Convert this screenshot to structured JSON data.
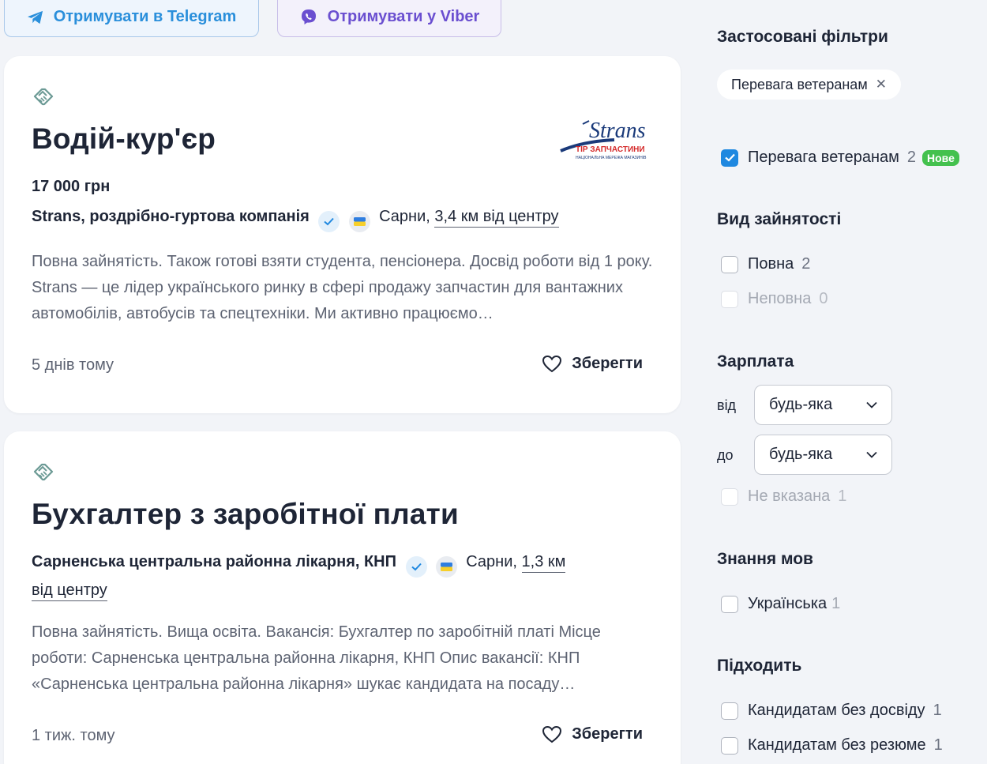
{
  "subscribe": {
    "telegram_label": "Отримувати в Telegram",
    "viber_label": "Отримувати у Viber"
  },
  "jobs": [
    {
      "title": "Водій-кур'єр",
      "salary": "17 000 грн",
      "company": "Strans, роздрібно-гуртова компанія",
      "city": "Сарни,",
      "distance": "3,4 км від центру",
      "description": "Повна зайнятість. Також готові взяти студента, пенсіонера. Досвід роботи від 1 року. Strans — це лідер українського ринку в сфері продажу запчастин для вантажних автомобілів, автобусів та спецтехніки. Ми активно працюємо…",
      "posted": "5 днів тому",
      "save_label": "Зберегти",
      "logo": {
        "text": "Strans",
        "subtext": "ТІР ЗАПЧАСТИНИ",
        "tagline": "НАЦІОНАЛЬНА МЕРЕЖА МАГАЗИНІВ"
      }
    },
    {
      "title": "Бухгалтер з заробітної плати",
      "company": "Сарненська центральна районна лікарня, КНП",
      "city": "Сарни,",
      "distance": "1,3 км від центру",
      "description": "Повна зайнятість. Вища освіта. Вакансія: Бухгалтер по заробітній платі Місце роботи: Сарненська центральна районна лікарня, КНП Опис вакансії: КНП «Сарненська центральна районна лікарня» шукає кандидата на посаду…",
      "posted": "1 тиж. тому",
      "save_label": "Зберегти"
    }
  ],
  "filters": {
    "applied_title": "Застосовані фільтри",
    "applied_chip": "Перевага ветеранам",
    "veterans": {
      "label": "Перевага ветеранам",
      "count": "2",
      "badge": "Нове",
      "checked": true
    },
    "employment": {
      "title": "Вид зайнятості",
      "options": [
        {
          "label": "Повна",
          "count": "2"
        },
        {
          "label": "Неповна",
          "count": "0"
        }
      ]
    },
    "salary": {
      "title": "Зарплата",
      "from_label": "від",
      "to_label": "до",
      "from_value": "будь-яка",
      "to_value": "будь-яка",
      "unspecified": {
        "label": "Не вказана",
        "count": "1"
      }
    },
    "languages": {
      "title": "Знання мов",
      "options": [
        {
          "label": "Українська",
          "count": "1"
        }
      ]
    },
    "suitable": {
      "title": "Підходить",
      "options": [
        {
          "label": "Кандидатам без досвіду",
          "count": "1"
        },
        {
          "label": "Кандидатам без резюме",
          "count": "1"
        }
      ]
    }
  },
  "colors": {
    "accent_blue": "#1f88e0",
    "telegram": "#2a8fdb",
    "viber": "#6a4fd0",
    "new_badge": "#44c14e",
    "background": "#f2f4f8"
  }
}
